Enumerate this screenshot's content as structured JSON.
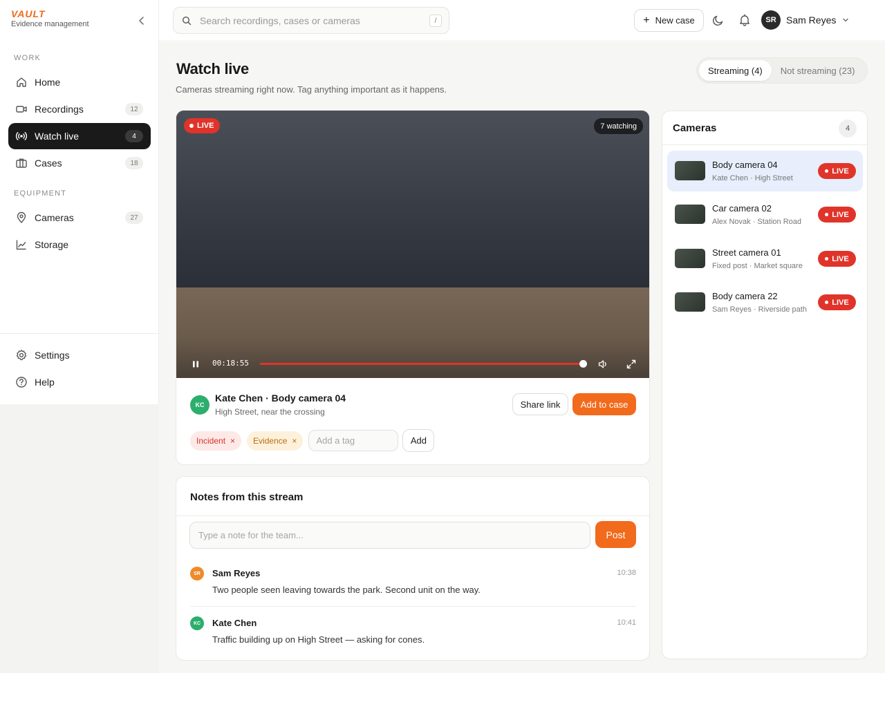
{
  "brand": {
    "logo": "VAULT",
    "subtitle": "Evidence management"
  },
  "sidebar": {
    "sections": [
      "WORK",
      "EQUIPMENT"
    ],
    "items": [
      {
        "label": "Home",
        "icon": "home-icon"
      },
      {
        "label": "Recordings",
        "icon": "video-icon",
        "count": "12"
      },
      {
        "label": "Watch live",
        "icon": "broadcast-icon",
        "count": "4",
        "active": true
      },
      {
        "label": "Cases",
        "icon": "briefcase-icon",
        "count": "18"
      },
      {
        "label": "Cameras",
        "icon": "map-pin-icon",
        "count": "27"
      },
      {
        "label": "Storage",
        "icon": "chart-line-icon"
      }
    ],
    "footer": [
      {
        "label": "Settings",
        "icon": "gear-icon"
      },
      {
        "label": "Help",
        "icon": "help-circle-icon"
      }
    ]
  },
  "search": {
    "placeholder": "Search recordings, cases or cameras",
    "shortcut": "/"
  },
  "topbar": {
    "new_case": "New case",
    "user_initials": "SR",
    "user_name": "Sam Reyes"
  },
  "page": {
    "title": "Watch live",
    "subtitle": "Cameras streaming right now. Tag anything important as it happens.",
    "tabs": [
      {
        "label": "Streaming (4)",
        "selected": true
      },
      {
        "label": "Not streaming (23)",
        "selected": false
      }
    ]
  },
  "player": {
    "live_label": "LIVE",
    "watching": "7 watching",
    "timecode": "00:18:55",
    "progress": 0.99,
    "stream_initials": "KC",
    "stream_title": "Kate Chen · Body camera 04",
    "stream_location": "High Street, near the crossing",
    "share_label": "Share link",
    "add_to_case_label": "Add to case",
    "tags": [
      {
        "label": "Incident",
        "remove": "×"
      },
      {
        "label": "Evidence",
        "remove": "×"
      }
    ],
    "tag_placeholder": "Add a tag",
    "tag_add_label": "Add"
  },
  "notes": {
    "title": "Notes from this stream",
    "placeholder": "Type a note for the team...",
    "post_label": "Post",
    "items": [
      {
        "initials": "SR",
        "name": "Sam Reyes",
        "time": "10:38",
        "text": "Two people seen leaving towards the park. Second unit on the way.",
        "color": "#ee8a2a"
      },
      {
        "initials": "KC",
        "name": "Kate Chen",
        "time": "10:41",
        "text": "Traffic building up on High Street — asking for cones.",
        "color": "#2cae6c"
      }
    ]
  },
  "cameras": {
    "title": "Cameras",
    "count": "4",
    "live_label": "LIVE",
    "items": [
      {
        "name": "Body camera 04",
        "detail": "Kate Chen · High Street",
        "selected": true
      },
      {
        "name": "Car camera 02",
        "detail": "Alex Novak · Station Road",
        "selected": false
      },
      {
        "name": "Street camera 01",
        "detail": "Fixed post · Market square",
        "selected": false
      },
      {
        "name": "Body camera 22",
        "detail": "Sam Reyes · Riverside path",
        "selected": false
      }
    ]
  },
  "colors": {
    "accent": "#f26a1b",
    "live": "#e0342a",
    "active_nav": "#1a1a1a",
    "selected_row": "#e8eefc"
  }
}
